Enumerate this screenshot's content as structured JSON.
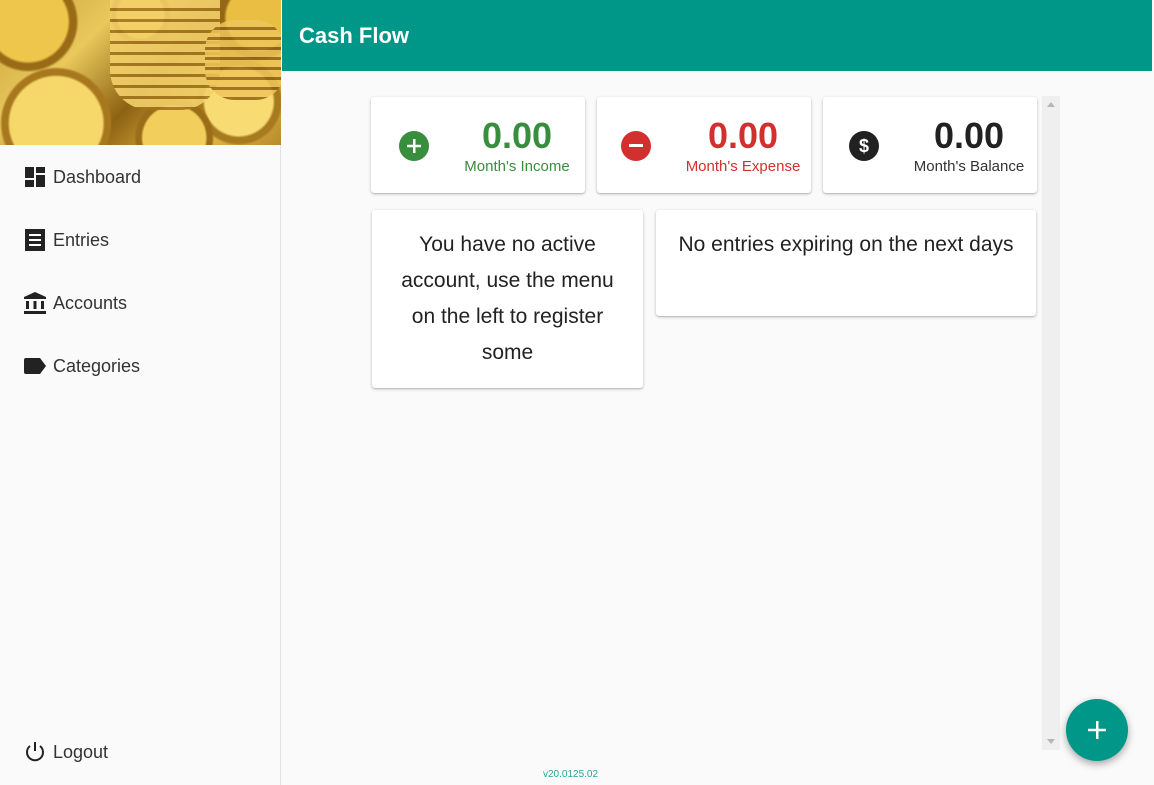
{
  "app": {
    "title": "Cash Flow",
    "version": "v20.0125.02"
  },
  "sidebar": {
    "items": [
      {
        "label": "Dashboard",
        "icon": "dashboard-icon"
      },
      {
        "label": "Entries",
        "icon": "receipt-icon"
      },
      {
        "label": "Accounts",
        "icon": "bank-icon"
      },
      {
        "label": "Categories",
        "icon": "label-tag-icon"
      }
    ],
    "logout": {
      "label": "Logout",
      "icon": "power-icon"
    }
  },
  "stats": {
    "income": {
      "value": "0.00",
      "label": "Month's Income",
      "color": "#388e3c",
      "icon": "plus-circle-icon"
    },
    "expense": {
      "value": "0.00",
      "label": "Month's Expense",
      "color": "#d32f2f",
      "icon": "minus-circle-icon"
    },
    "balance": {
      "value": "0.00",
      "label": "Month's Balance",
      "color": "#212121",
      "icon": "dollar-circle-icon"
    }
  },
  "messages": {
    "no_accounts": "You have no active account, use the menu on the left to register some",
    "no_expiring": "No entries expiring on the next days"
  },
  "fab": {
    "icon": "add-icon"
  },
  "colors": {
    "primary": "#009688"
  }
}
